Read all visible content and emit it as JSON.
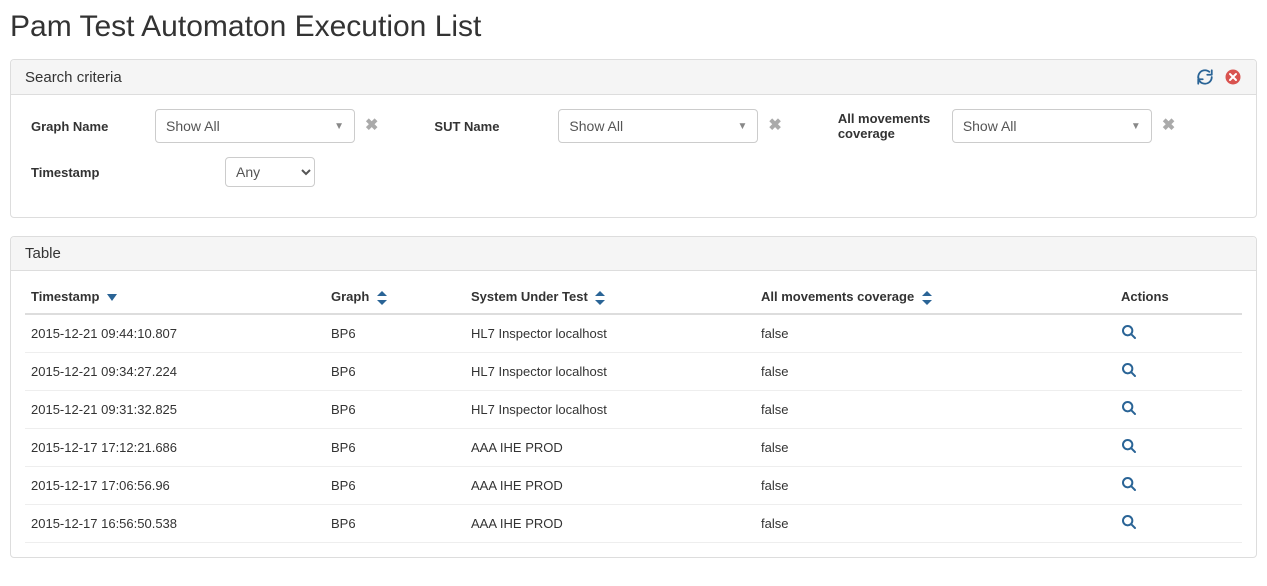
{
  "page": {
    "title": "Pam Test Automaton Execution List"
  },
  "panels": {
    "search": {
      "title": "Search criteria"
    },
    "table": {
      "title": "Table"
    }
  },
  "criteria": {
    "graph_name": {
      "label": "Graph Name",
      "value": "Show All"
    },
    "sut_name": {
      "label": "SUT Name",
      "value": "Show All"
    },
    "amc": {
      "label": "All movements coverage",
      "value": "Show All"
    },
    "timestamp": {
      "label": "Timestamp",
      "value": "Any"
    }
  },
  "columns": {
    "timestamp": "Timestamp",
    "graph": "Graph",
    "sut": "System Under Test",
    "amc": "All movements coverage",
    "actions": "Actions"
  },
  "rows": [
    {
      "timestamp": "2015-12-21 09:44:10.807",
      "graph": "BP6",
      "sut": "HL7 Inspector localhost",
      "amc": "false"
    },
    {
      "timestamp": "2015-12-21 09:34:27.224",
      "graph": "BP6",
      "sut": "HL7 Inspector localhost",
      "amc": "false"
    },
    {
      "timestamp": "2015-12-21 09:31:32.825",
      "graph": "BP6",
      "sut": "HL7 Inspector localhost",
      "amc": "false"
    },
    {
      "timestamp": "2015-12-17 17:12:21.686",
      "graph": "BP6",
      "sut": "AAA IHE PROD",
      "amc": "false"
    },
    {
      "timestamp": "2015-12-17 17:06:56.96",
      "graph": "BP6",
      "sut": "AAA IHE PROD",
      "amc": "false"
    },
    {
      "timestamp": "2015-12-17 16:56:50.538",
      "graph": "BP6",
      "sut": "AAA IHE PROD",
      "amc": "false"
    }
  ],
  "colors": {
    "link": "#2a6496",
    "danger": "#d9534f"
  }
}
